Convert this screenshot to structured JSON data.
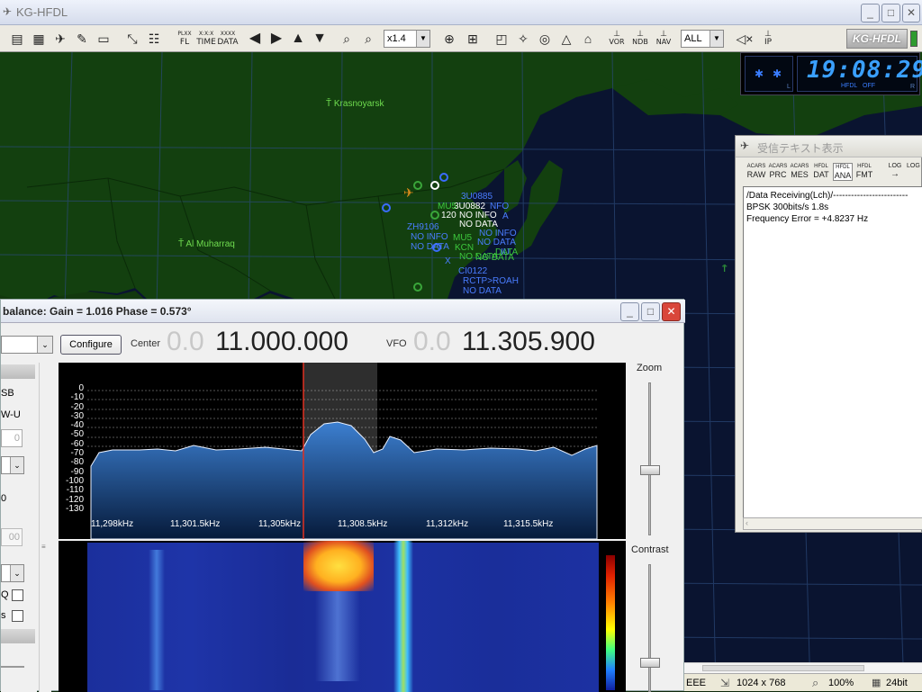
{
  "app": {
    "title": "KG-HFDL",
    "logo_text": "KG-HFDL"
  },
  "toolbar": {
    "zoom_value": "x1.4",
    "filter_value": "ALL",
    "text_buttons": [
      {
        "name": "fl-button",
        "label": "FL",
        "top": "PLXX"
      },
      {
        "name": "time-button",
        "label": "TIME",
        "top": "X:X:X"
      },
      {
        "name": "data-button",
        "label": "DATA",
        "top": "XXXX"
      },
      {
        "name": "vor-button",
        "label": "VOR",
        "top": ""
      },
      {
        "name": "ndb-button",
        "label": "NDB",
        "top": ""
      },
      {
        "name": "nav-button",
        "label": "NAV",
        "top": ""
      },
      {
        "name": "ip-button",
        "label": "IP",
        "top": ""
      }
    ]
  },
  "clock": {
    "time": "19:08:29",
    "hfdl_label": "HFDL",
    "off_label": "OFF",
    "l": "L",
    "r": "R"
  },
  "map": {
    "cities": [
      {
        "name": "Krasnoyarsk"
      },
      {
        "name": "Al Muharraq"
      }
    ],
    "flight_labels": [
      "3U0885",
      "3U0882",
      "NFO",
      "MU5",
      "NO INFO",
      "A",
      "120",
      "NO DATA",
      "ZH9106",
      "NO INFO",
      "NO INFO",
      "NO DATA",
      "MU5",
      "NO DATA",
      "KCN",
      "NO DATA",
      "DATA",
      "IU",
      "X",
      "NO DATA",
      "CI0122",
      "RCTP>ROAH",
      "NO DATA"
    ]
  },
  "rx_window": {
    "title": "受信テキスト表示",
    "buttons": [
      {
        "top": "ACARS",
        "bottom": "RAW"
      },
      {
        "top": "ACARS",
        "bottom": "PRC"
      },
      {
        "top": "ACARS",
        "bottom": "MES"
      },
      {
        "top": "HFDL",
        "bottom": "DAT"
      },
      {
        "top": "HFDL",
        "bottom": "ANA"
      },
      {
        "top": "HFDL",
        "bottom": "FMT"
      },
      {
        "top": "LOG",
        "bottom": "→"
      },
      {
        "top": "LOG",
        "bottom": ""
      }
    ],
    "lines": [
      "/Data Receiving(Lch)/-------------------------",
      "BPSK 300bits/s 1.8s",
      "Frequency Error = +4.8237 Hz"
    ]
  },
  "sdr_window": {
    "title": "balance: Gain = 1.016 Phase = 0.573°",
    "configure_label": "Configure",
    "center_label": "Center",
    "center_dim": "0.0",
    "center_value": "11.000.000",
    "vfo_label": "VFO",
    "vfo_dim": "0.0",
    "vfo_value": "11.305.900",
    "zoom_label": "Zoom",
    "contrast_label": "Contrast",
    "left_labels": {
      "sb": "SB",
      "wu": "W-U",
      "v1": "0",
      "v2": "0",
      "v3": "00",
      "q": "Q",
      "s": "s"
    },
    "db_ticks": [
      "0",
      "-10",
      "-20",
      "-30",
      "-40",
      "-50",
      "-60",
      "-70",
      "-80",
      "-90",
      "-100",
      "-110",
      "-120",
      "-130"
    ],
    "freq_ticks": [
      "11,298kHz",
      "11,301.5kHz",
      "11,305kHz",
      "11,308.5kHz",
      "11,312kHz",
      "11,315.5kHz"
    ]
  },
  "statusbar": {
    "left": "EEE",
    "resolution": "1024 x 768",
    "zoom": "100%",
    "depth": "24bit"
  }
}
